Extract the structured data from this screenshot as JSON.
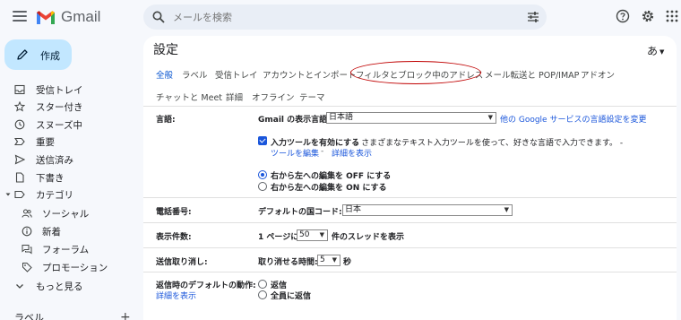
{
  "app": {
    "name": "Gmail"
  },
  "search": {
    "placeholder": "メールを検索"
  },
  "sidebar": {
    "compose_label": "作成",
    "items": [
      {
        "label": "受信トレイ",
        "icon": "inbox-icon"
      },
      {
        "label": "スター付き",
        "icon": "star-icon"
      },
      {
        "label": "スヌーズ中",
        "icon": "clock-icon"
      },
      {
        "label": "重要",
        "icon": "label-important-icon"
      },
      {
        "label": "送信済み",
        "icon": "send-icon"
      },
      {
        "label": "下書き",
        "icon": "draft-icon"
      },
      {
        "label": "カテゴリ",
        "icon": "label-icon"
      },
      {
        "label": "ソーシャル",
        "icon": "people-icon"
      },
      {
        "label": "新着",
        "icon": "info-icon"
      },
      {
        "label": "フォーラム",
        "icon": "forum-icon"
      },
      {
        "label": "プロモーション",
        "icon": "tag-icon"
      },
      {
        "label": "もっと見る",
        "icon": "chevron-down-icon"
      }
    ],
    "labels_heading": "ラベル",
    "add_label": "+"
  },
  "settings": {
    "title": "設定",
    "lang_switch": "あ",
    "tabs": [
      {
        "label": "全般",
        "active": true
      },
      {
        "label": "ラベル"
      },
      {
        "label": "受信トレイ"
      },
      {
        "label": "アカウントとインポート"
      },
      {
        "label": "フィルタとブロック中のアドレス"
      },
      {
        "label": "メール転送と POP/IMAP"
      },
      {
        "label": "アドオン"
      },
      {
        "label": "チャットと Meet"
      },
      {
        "label": "詳細"
      },
      {
        "label": "オフライン"
      },
      {
        "label": "テーマ"
      }
    ],
    "language": {
      "label": "言語:",
      "display_lang_label": "Gmail の表示言語:",
      "display_lang_value": "日本語",
      "other_services_link": "他の Google サービスの言語設定を変更",
      "input_tools_bold": "入力ツールを有効にする",
      "input_tools_desc": " - さまざまなテキスト入力ツールを使って、好きな言語で入力できます。 -",
      "edit_tools_link": "ツールを編集",
      "separator": " - ",
      "details_link": "詳細を表示",
      "rtl_off": "右から左への編集を OFF にする",
      "rtl_on": "右から左への編集を ON にする"
    },
    "phone": {
      "label": "電話番号:",
      "country_label": "デフォルトの国コード:",
      "country_value": "日本"
    },
    "page_size": {
      "label": "表示件数:",
      "prefix": "1 ページに",
      "value": "50",
      "suffix": "件のスレッドを表示"
    },
    "undo_send": {
      "label": "送信取り消し:",
      "time_label": "取り消せる時間:",
      "value": "5",
      "unit": "秒"
    },
    "reply_default": {
      "label": "返信時のデフォルトの動作:",
      "details_link": "詳細を表示",
      "opt_reply": "返信",
      "opt_reply_all": "全員に返信"
    }
  },
  "colors": {
    "accent": "#0b57d0",
    "link": "#1a56db",
    "compose_bg": "#c2e7ff",
    "annotation": "#c00000"
  }
}
